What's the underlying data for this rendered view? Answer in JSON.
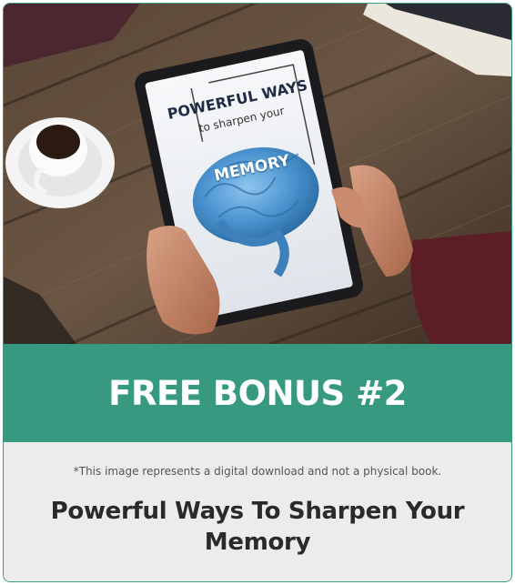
{
  "hero": {
    "cover": {
      "line1": "POWERFUL WAYS",
      "line2": "to sharpen your",
      "line3": "MEMORY"
    }
  },
  "banner": {
    "title": "FREE BONUS #2",
    "color": "#379a80"
  },
  "info": {
    "disclaimer": "*This image represents a digital download and not a physical book.",
    "product_title": "Powerful Ways To Sharpen Your Memory"
  }
}
